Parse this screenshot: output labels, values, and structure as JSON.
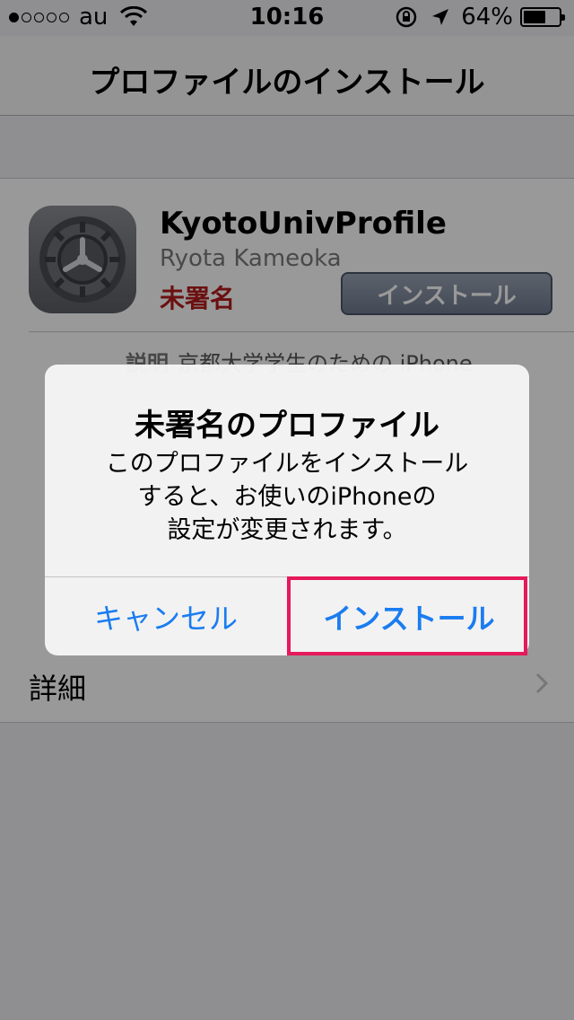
{
  "status_bar": {
    "carrier": "au",
    "time": "10:16",
    "battery_percent_text": "64%",
    "battery_level": 0.64,
    "signal_bars_filled": 1,
    "signal_bars_total": 5
  },
  "navbar": {
    "title": "プロファイルのインストール"
  },
  "profile": {
    "name": "KyotoUnivProfile",
    "author": "Ryota Kameoka",
    "status": "未署名",
    "install_button": "インストール",
    "description_label": "説明",
    "description_text": "京都大学学生のための iPhone"
  },
  "detail": {
    "label": "詳細"
  },
  "alert": {
    "title": "未署名のプロファイル",
    "message_line1": "このプロファイルをインストール",
    "message_line2": "すると、お使いのiPhoneの",
    "message_line3": "設定が変更されます。",
    "cancel_label": "キャンセル",
    "install_label": "インストール"
  },
  "colors": {
    "accent": "#1a7cf0",
    "unsigned": "#b21c1c",
    "highlight": "#e6195a"
  },
  "icons": {
    "app_icon": "settings-gear-icon",
    "wifi": "wifi-icon",
    "rotation_lock": "rotation-lock-icon",
    "location": "location-arrow-icon",
    "battery": "battery-icon",
    "chevron": "chevron-right-icon"
  }
}
